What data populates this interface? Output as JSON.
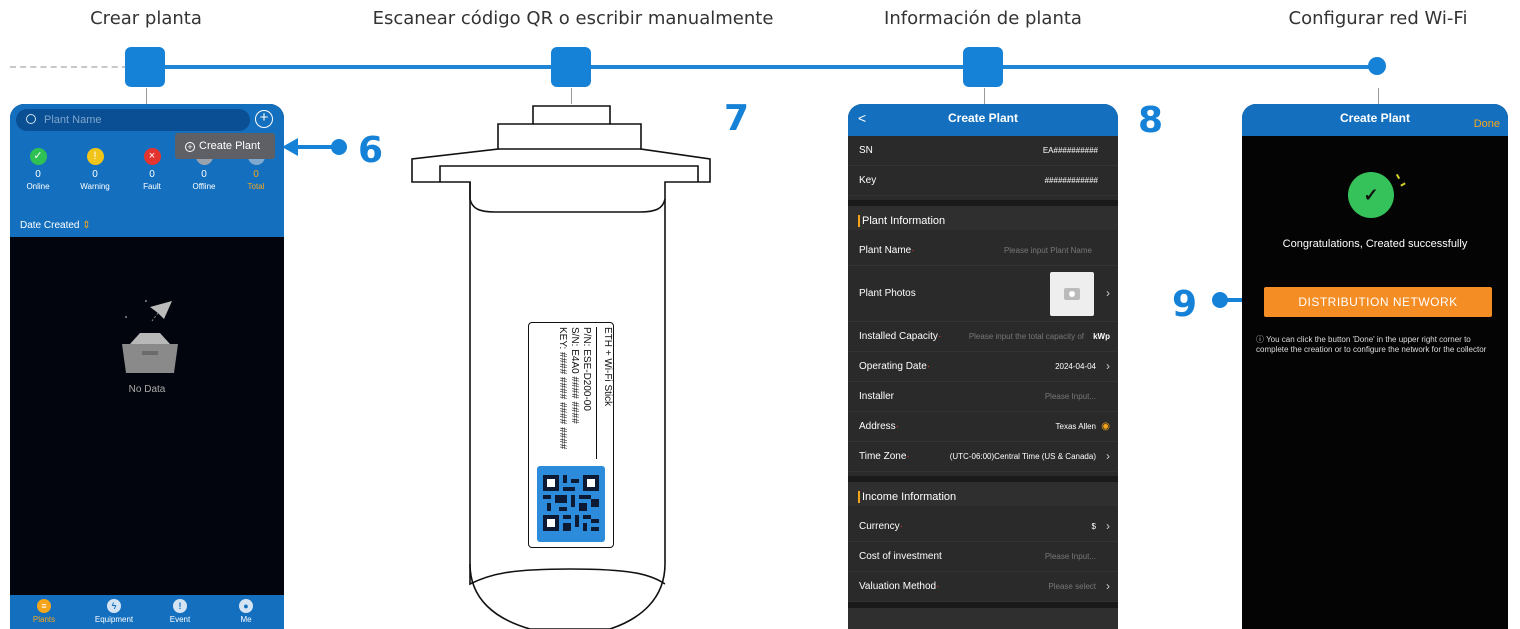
{
  "steps": {
    "titles": [
      "Crear planta",
      "Escanear código QR o escribir manualmente",
      "Información de planta",
      "Configurar red Wi-Fi"
    ],
    "numbers": [
      "6",
      "7",
      "8",
      "9"
    ]
  },
  "phone1": {
    "search_placeholder": "Plant Name",
    "create_plant_label": "Create Plant",
    "stats": [
      {
        "label": "Online",
        "value": "0",
        "color": "#2fc153"
      },
      {
        "label": "Warning",
        "value": "0",
        "color": "#f0c419"
      },
      {
        "label": "Fault",
        "value": "0",
        "color": "#e3342f"
      },
      {
        "label": "Offline",
        "value": "0",
        "color": "#9aa3ad"
      },
      {
        "label": "Total",
        "value": "0",
        "color": "#f5a51c"
      }
    ],
    "sort_label": "Date Created",
    "sort_arrow": "⇕",
    "empty_text": "No Data",
    "tabs": [
      "Plants",
      "Equipment",
      "Event",
      "Me"
    ]
  },
  "device": {
    "product": "ETH + Wi-Fi Stick",
    "pn": "P/N: ESE-D200-00",
    "sn": "S/N: E4A0 #### ####",
    "key": "KEY: #### #### #### ####"
  },
  "phone3": {
    "header_title": "Create Plant",
    "sn_label": "SN",
    "sn_value": "EA##########",
    "key_label": "Key",
    "key_value": "############",
    "section_plant": "Plant Information",
    "plant_name_label": "Plant Name",
    "plant_name_placeholder": "Please input Plant Name",
    "plant_photos_label": "Plant Photos",
    "installed_capacity_label": "Installed Capacity",
    "installed_capacity_placeholder": "Please input the total capacity of",
    "installed_capacity_unit": "kWp",
    "operating_date_label": "Operating Date",
    "operating_date_value": "2024-04-04",
    "installer_label": "Installer",
    "installer_placeholder": "Please Input...",
    "address_label": "Address",
    "address_value": "Texas Allen",
    "time_zone_label": "Time Zone",
    "time_zone_value": "(UTC-06:00)Central Time (US & Canada)",
    "section_income": "Income Information",
    "currency_label": "Currency",
    "currency_value": "$",
    "cost_label": "Cost of investment",
    "cost_placeholder": "Please Input...",
    "valuation_label": "Valuation Method",
    "valuation_placeholder": "Please select"
  },
  "phone4": {
    "header_title": "Create Plant",
    "done_label": "Done",
    "congrats_text": "Congratulations, Created successfully",
    "dist_button_label": "DISTRIBUTION NETWORK",
    "note_text": "ⓘ You can click the button 'Done' in the upper right corner to complete the creation or to configure the network for the collector"
  },
  "colors": {
    "brand_blue": "#1582d8",
    "app_blue": "#1470bf",
    "orange": "#f48d24"
  }
}
